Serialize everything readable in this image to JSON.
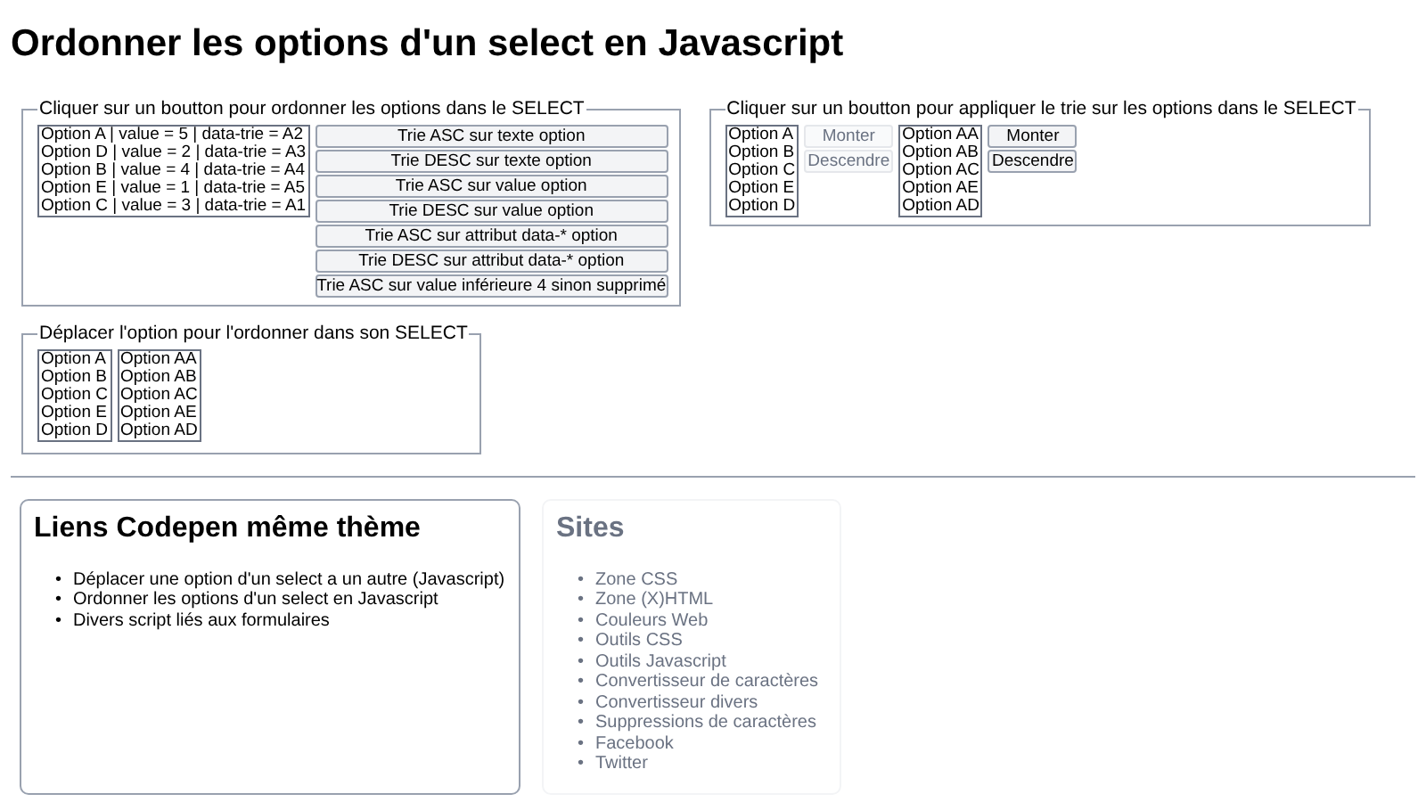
{
  "title": "Ordonner les options d'un select en Javascript",
  "sort_panel": {
    "legend": "Cliquer sur un boutton pour ordonner les options dans le SELECT",
    "options": [
      "Option A | value = 5 | data-trie = A2",
      "Option D | value = 2 | data-trie = A3",
      "Option B | value = 4 | data-trie = A4",
      "Option E | value = 1 | data-trie = A5",
      "Option C | value = 3 | data-trie = A1"
    ],
    "buttons": [
      "Trie ASC sur texte option",
      "Trie DESC sur texte option",
      "Trie ASC sur value option",
      "Trie DESC sur value option",
      "Trie ASC sur attribut data-* option",
      "Trie DESC sur attribut data-* option",
      "Trie ASC sur value inférieure 4 sinon supprimé"
    ]
  },
  "move_panel": {
    "legend": "Cliquer sur un boutton pour appliquer le trie sur les options dans le SELECT",
    "groups": [
      {
        "options": [
          "Option A",
          "Option B",
          "Option C",
          "Option E",
          "Option D"
        ],
        "buttons": [
          {
            "label": "Monter",
            "disabled": true
          },
          {
            "label": "Descendre",
            "disabled": true
          }
        ]
      },
      {
        "options": [
          "Option AA",
          "Option AB",
          "Option AC",
          "Option AE",
          "Option AD"
        ],
        "buttons": [
          {
            "label": "Monter",
            "disabled": false
          },
          {
            "label": "Descendre",
            "disabled": false
          }
        ]
      }
    ]
  },
  "drag_panel": {
    "legend": "Déplacer l'option pour l'ordonner dans son SELECT",
    "lists": [
      [
        "Option A",
        "Option B",
        "Option C",
        "Option E",
        "Option D"
      ],
      [
        "Option AA",
        "Option AB",
        "Option AC",
        "Option AE",
        "Option AD"
      ]
    ]
  },
  "cards": [
    {
      "title": "Liens Codepen même thème",
      "dimmed": false,
      "bullet": "•",
      "links": [
        "Déplacer une option d'un select a un autre (Javascript)",
        "Ordonner les options d'un select en Javascript",
        "Divers script liés aux formulaires"
      ]
    },
    {
      "title": "Sites",
      "dimmed": true,
      "bullet": "•",
      "links": [
        "Zone CSS",
        "Zone (X)HTML",
        "Couleurs Web",
        "Outils CSS",
        "Outils Javascript",
        "Convertisseur de caractères",
        "Convertisseur divers",
        "Suppressions de caractères",
        "Facebook",
        "Twitter"
      ]
    }
  ]
}
